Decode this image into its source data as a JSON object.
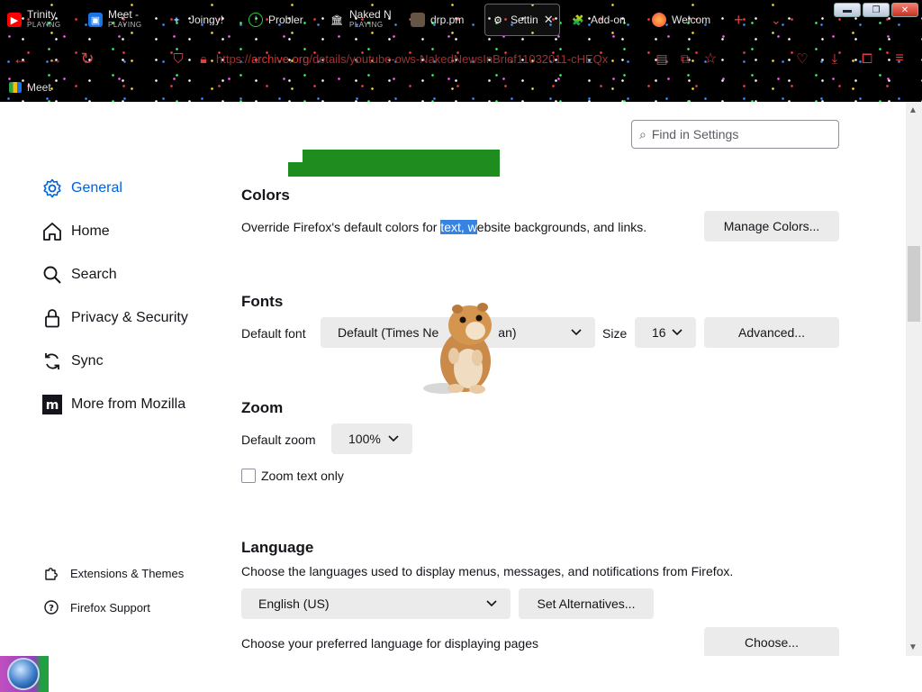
{
  "tabs": [
    {
      "title": "Trinity",
      "sub": "PLAYING",
      "icon": "youtube-icon",
      "color": "#ff0000"
    },
    {
      "title": "Meet -",
      "sub": "PLAYING",
      "icon": "meet-icon",
      "color": "#1a73e8"
    },
    {
      "title": "Joingy!",
      "sub": "",
      "icon": "joingy-icon",
      "color": "#3b5bdb"
    },
    {
      "title": "Probler",
      "sub": "",
      "icon": "problem-icon",
      "color": "#2ecc40"
    },
    {
      "title": "Naked N",
      "sub": "PLAYING",
      "icon": "archive-icon",
      "color": "#ffffff"
    },
    {
      "title": "drp.pm",
      "sub": "",
      "icon": "drp-icon",
      "color": "#887755"
    },
    {
      "title": "Settin",
      "sub": "",
      "icon": "gear-icon",
      "color": "#ffffff"
    },
    {
      "title": "Add-on",
      "sub": "",
      "icon": "puzzle-icon",
      "color": "#ffffff"
    },
    {
      "title": "Welcom",
      "sub": "",
      "icon": "firefox-icon",
      "color": "#ff7139"
    }
  ],
  "url": {
    "prefix": "https://",
    "host": "archive.org",
    "path": "/details/youtube-ows-NakedNewsInBrief11032011-cHEQx"
  },
  "bookmark": {
    "label": "Meet"
  },
  "search": {
    "placeholder": "Find in Settings"
  },
  "sidebar": {
    "items": [
      {
        "label": "General",
        "icon": "gear-icon",
        "selected": true
      },
      {
        "label": "Home",
        "icon": "home-icon"
      },
      {
        "label": "Search",
        "icon": "search-icon"
      },
      {
        "label": "Privacy & Security",
        "icon": "lock-icon"
      },
      {
        "label": "Sync",
        "icon": "sync-icon"
      },
      {
        "label": "More from Mozilla",
        "icon": "mozilla-icon"
      }
    ],
    "footer": [
      {
        "label": "Extensions & Themes",
        "icon": "puzzle-icon"
      },
      {
        "label": "Firefox Support",
        "icon": "help-icon"
      }
    ]
  },
  "colors": {
    "title": "Colors",
    "desc_before": "Override Firefox's default colors for ",
    "desc_highlight": "text, w",
    "desc_after": "ebsite backgrounds, and links.",
    "button": "Manage Colors..."
  },
  "fonts": {
    "title": "Fonts",
    "default_label": "Default font",
    "default_value": "Default (Times Ne",
    "default_value_tail": "an)",
    "size_label": "Size",
    "size_value": "16",
    "advanced_button": "Advanced..."
  },
  "zoom": {
    "title": "Zoom",
    "default_label": "Default zoom",
    "default_value": "100%",
    "text_only_label": "Zoom text only",
    "text_only_checked": false
  },
  "language": {
    "title": "Language",
    "desc": "Choose the languages used to display menus, messages, and notifications from Firefox.",
    "value": "English (US)",
    "alternatives_button": "Set Alternatives...",
    "pages_desc": "Choose your preferred language for displaying pages",
    "choose_button": "Choose..."
  },
  "accent": "#0061e0"
}
